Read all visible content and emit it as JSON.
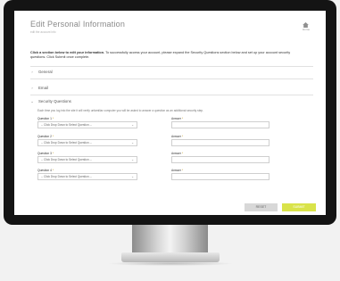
{
  "header": {
    "title": "Edit Personal Information",
    "subtitle": "edit the account info",
    "home_label": "Home"
  },
  "instruction": {
    "bold": "Click a section below to edit your information.",
    "text": " To successfully access your account, please expand the Security Questions section below and set up your account security questions. Click Submit once complete."
  },
  "sections": [
    {
      "label": "General",
      "expanded": false
    },
    {
      "label": "Email",
      "expanded": false
    },
    {
      "label": "Security Questions",
      "expanded": true
    }
  ],
  "security": {
    "note": "Each time you log into the site it will verify unfamiliar computer you will be asked to answer a question as an additional security step.",
    "questions": [
      {
        "label": "Question 1",
        "value": "-- Click Drop Down to Select Question --",
        "answer_label": "Answer"
      },
      {
        "label": "Question 2",
        "value": "-- Click Drop Down to Select Question --",
        "answer_label": "Answer"
      },
      {
        "label": "Question 3",
        "value": "-- Click Drop Down to Select Question --",
        "answer_label": "Answer"
      },
      {
        "label": "Question 4",
        "value": "-- Click Drop Down to Select Question --",
        "answer_label": "Answer"
      }
    ]
  },
  "buttons": {
    "reset": "RESET",
    "submit": "SUBMIT"
  },
  "colors": {
    "accent": "#d9e34a",
    "required": "#c9a227",
    "bezel": "#141414"
  }
}
